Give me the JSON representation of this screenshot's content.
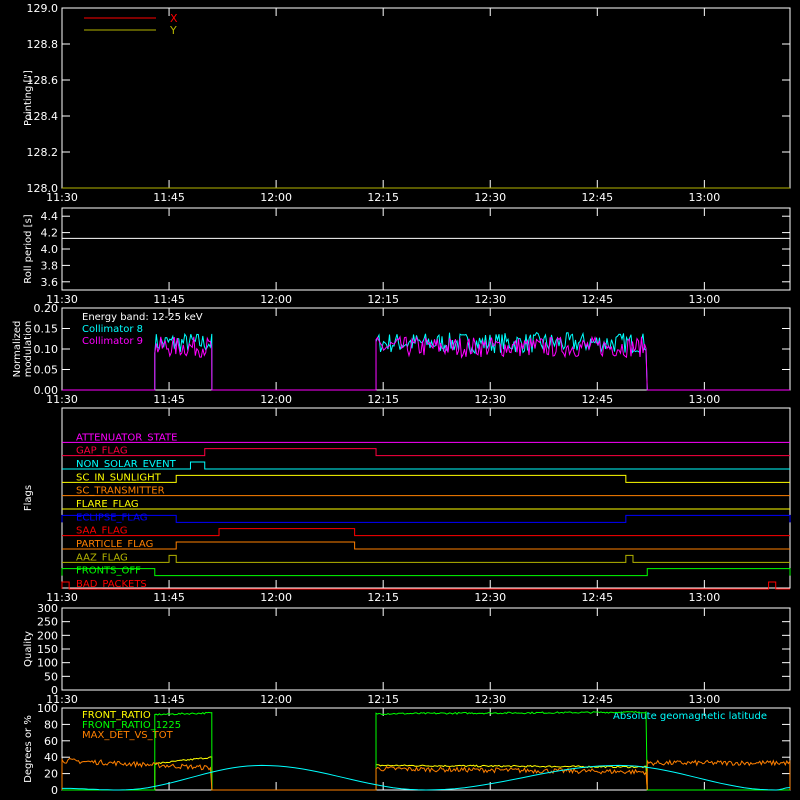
{
  "time_axis": {
    "range": [
      "11:30",
      "13:12"
    ],
    "tick_labels": [
      "11:30",
      "11:45",
      "12:00",
      "12:15",
      "12:30",
      "12:45",
      "13:00"
    ]
  },
  "colors": {
    "background": "#000000",
    "axes": "#ffffff",
    "x_pointing": "#ff0000",
    "y_pointing": "#b4b400",
    "collimator_8": "#00ffff",
    "collimator_9": "#ff00ff",
    "front_ratio": "#ffff00",
    "front_ratio_1225": "#00ff00",
    "max_det_vs_tot": "#ff8000",
    "latitude": "#00ffff"
  },
  "chart_data": [
    {
      "id": "pointing",
      "type": "line",
      "ylabel": "Pointing [\"]",
      "ylim": [
        128.0,
        129.0
      ],
      "yticks": [
        "128.0",
        "128.2",
        "128.4",
        "128.6",
        "128.8",
        "129.0"
      ],
      "legend": [
        "X",
        "Y"
      ],
      "series": [
        {
          "name": "X",
          "values": [
            128.0,
            128.0
          ]
        },
        {
          "name": "Y",
          "values": [
            128.0,
            128.0
          ]
        }
      ]
    },
    {
      "id": "roll",
      "type": "line",
      "ylabel": "Roll period [s]",
      "ylim": [
        3.5,
        4.5
      ],
      "yticks": [
        "3.6",
        "3.8",
        "4.0",
        "4.2",
        "4.4"
      ],
      "series": [
        {
          "values": [
            4.13,
            4.13
          ]
        }
      ]
    },
    {
      "id": "modulation",
      "type": "line",
      "ylabel": "Normalized modulation",
      "ylim": [
        0.0,
        0.2
      ],
      "yticks": [
        "0.00",
        "0.05",
        "0.10",
        "0.15",
        "0.20"
      ],
      "annotation": "Energy band: 12-25 keV",
      "legend": [
        "Collimator 8",
        "Collimator 9"
      ],
      "intervals": [
        [
          "11:43",
          "11:51"
        ],
        [
          "12:14",
          "12:52"
        ]
      ],
      "series": [
        {
          "name": "Collimator 8",
          "level": 0.115
        },
        {
          "name": "Collimator 9",
          "level": 0.105
        }
      ]
    },
    {
      "id": "flags",
      "type": "step",
      "ylabel": "Flags",
      "flags": [
        {
          "name": "ATTENUATOR_STATE",
          "color": "#ff00ff",
          "on": []
        },
        {
          "name": "GAP_FLAG",
          "color": "#ff0040",
          "on": [
            [
              "11:50",
              "12:14"
            ]
          ]
        },
        {
          "name": "NON_SOLAR_EVENT",
          "color": "#00ffff",
          "on": [
            [
              "11:48",
              "11:50"
            ]
          ]
        },
        {
          "name": "SC_IN_SUNLIGHT",
          "color": "#ffff00",
          "on": [
            [
              "11:46",
              "12:49"
            ]
          ]
        },
        {
          "name": "SC_TRANSMITTER",
          "color": "#ff8000",
          "on": []
        },
        {
          "name": "FLARE_FLAG",
          "color": "#ffff00",
          "on": []
        },
        {
          "name": "ECLIPSE_FLAG",
          "color": "#0000ff",
          "on": [
            [
              "11:30",
              "11:46"
            ],
            [
              "12:49",
              "13:12"
            ]
          ]
        },
        {
          "name": "SAA_FLAG",
          "color": "#ff0000",
          "on": [
            [
              "11:52",
              "12:11"
            ]
          ]
        },
        {
          "name": "PARTICLE_FLAG",
          "color": "#ff8000",
          "on": [
            [
              "11:46",
              "12:11"
            ]
          ]
        },
        {
          "name": "AAZ_FLAG",
          "color": "#b4b400",
          "on": [
            [
              "11:45",
              "11:46"
            ],
            [
              "12:49",
              "12:50"
            ]
          ]
        },
        {
          "name": "FRONTS_OFF",
          "color": "#00ff00",
          "on": [
            [
              "11:30",
              "11:43"
            ],
            [
              "12:52",
              "13:12"
            ]
          ]
        },
        {
          "name": "BAD_PACKETS",
          "color": "#ff0000",
          "on": [
            [
              "11:30",
              "11:31"
            ],
            [
              "13:09",
              "13:10"
            ]
          ]
        }
      ]
    },
    {
      "id": "quality",
      "type": "line",
      "ylabel": "Quality",
      "ylim": [
        0,
        300
      ],
      "yticks": [
        "0",
        "50",
        "100",
        "150",
        "200",
        "250",
        "300"
      ],
      "series": []
    },
    {
      "id": "percent",
      "type": "line",
      "ylabel": "Degrees or %",
      "ylim": [
        0,
        100
      ],
      "yticks": [
        "0",
        "20",
        "40",
        "60",
        "80",
        "100"
      ],
      "legend": [
        "FRONT_RATIO",
        "FRONT_RATIO_1225",
        "MAX_DET_VS_TOT"
      ],
      "right_label": "Absolute geomagnetic latitude",
      "series": [
        {
          "name": "FRONT_RATIO",
          "segments": [
            {
              "x": [
                "11:43",
                "11:51"
              ],
              "y": [
                32,
                40
              ]
            },
            {
              "x": [
                "12:14",
                "12:52"
              ],
              "y": [
                30,
                28
              ]
            }
          ]
        },
        {
          "name": "FRONT_RATIO_1225",
          "segments": [
            {
              "x": [
                "11:43",
                "11:51"
              ],
              "y": [
                92,
                94
              ]
            },
            {
              "x": [
                "12:14",
                "12:52"
              ],
              "y": [
                93,
                95
              ]
            }
          ]
        },
        {
          "name": "MAX_DET_VS_TOT",
          "segments": [
            {
              "x": [
                "11:30",
                "11:51"
              ],
              "y": [
                36,
                27
              ]
            },
            {
              "x": [
                "12:14",
                "12:52"
              ],
              "y": [
                26,
                22
              ]
            },
            {
              "x": [
                "12:52",
                "13:12"
              ],
              "y": [
                33,
                33
              ]
            }
          ]
        },
        {
          "name": "Absolute geomagnetic latitude",
          "points": [
            [
              "11:30",
              2
            ],
            [
              "11:38",
              0
            ],
            [
              "11:58",
              30
            ],
            [
              "12:21",
              0
            ],
            [
              "12:48",
              30
            ],
            [
              "13:10",
              0
            ],
            [
              "13:12",
              3
            ]
          ]
        }
      ]
    }
  ]
}
